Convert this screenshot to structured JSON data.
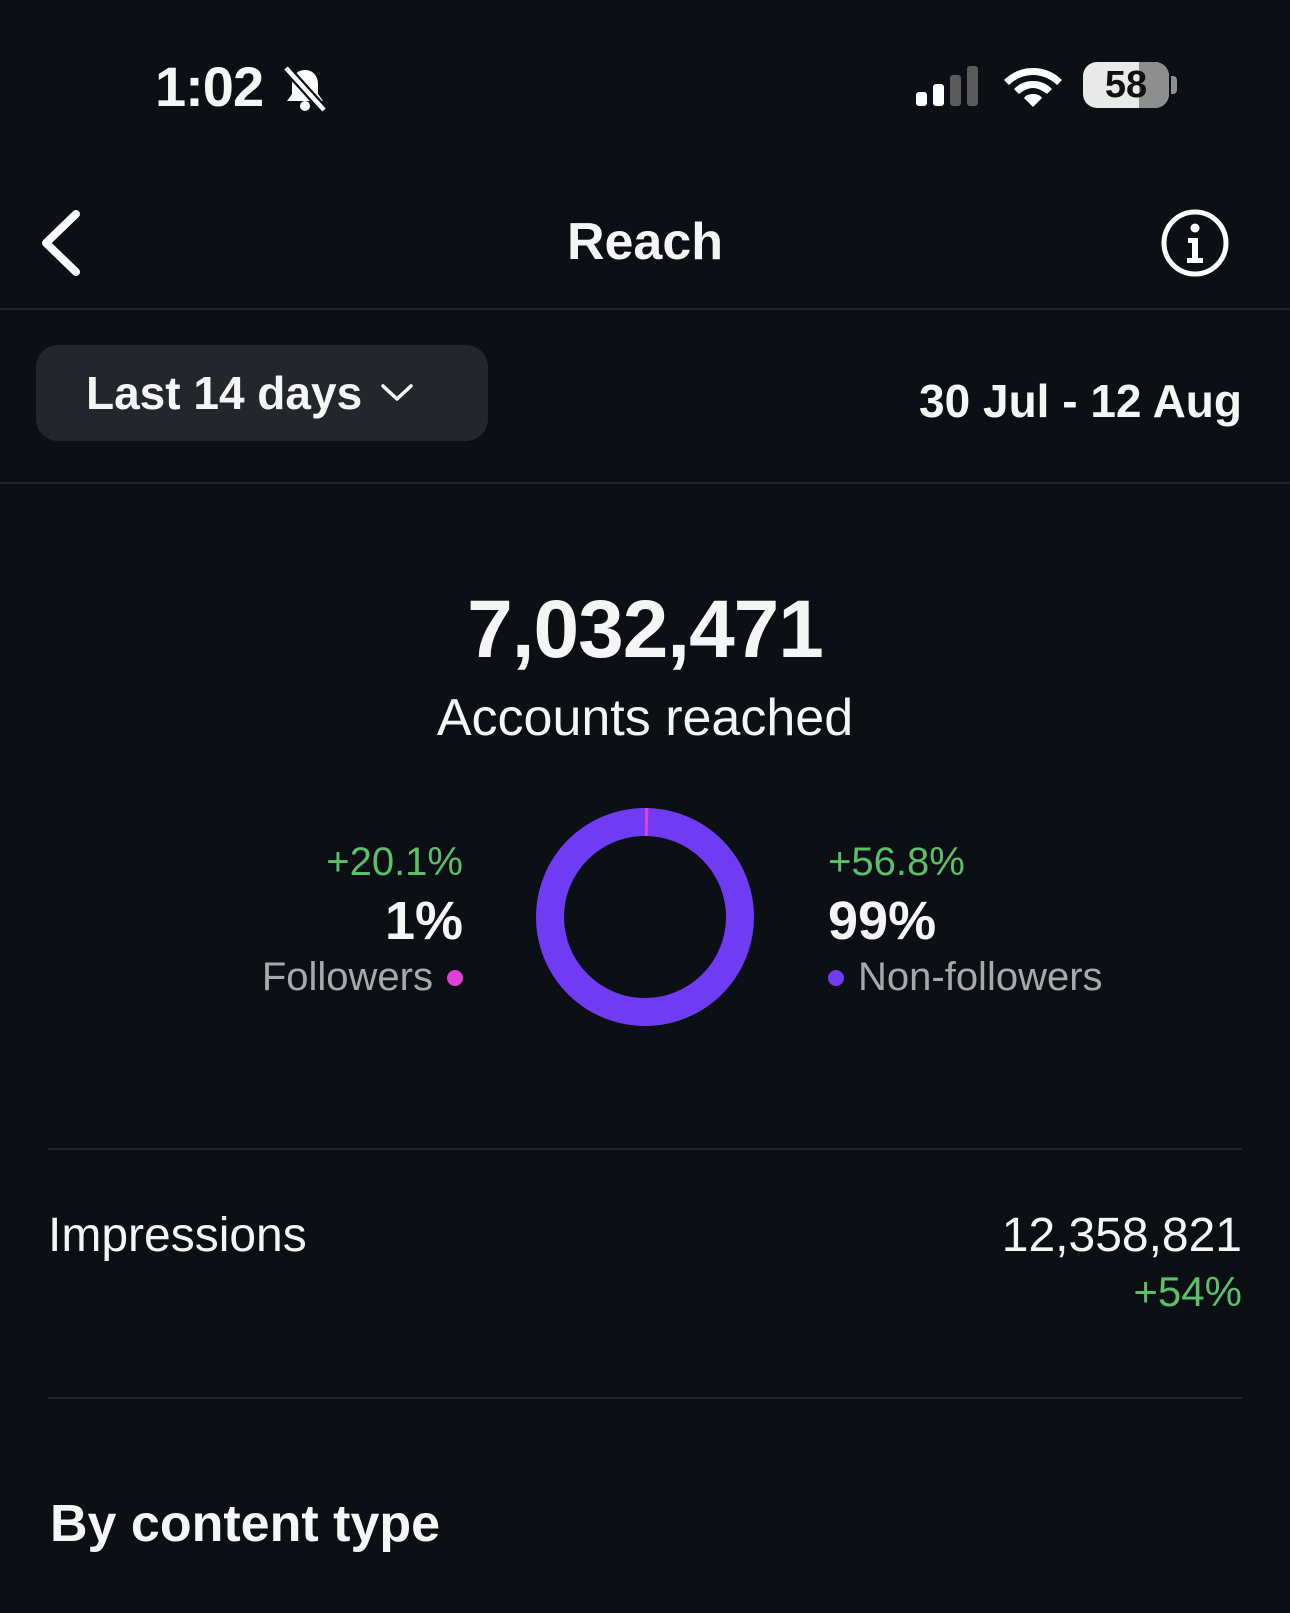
{
  "status_bar": {
    "time": "1:02",
    "battery": "58"
  },
  "nav": {
    "title": "Reach"
  },
  "filter": {
    "range_label": "Last 14 days",
    "date_range": "30 Jul - 12 Aug"
  },
  "summary": {
    "total": "7,032,471",
    "label": "Accounts reached"
  },
  "breakdown": {
    "followers": {
      "change": "+20.1%",
      "percent": "1%",
      "label": "Followers",
      "share": 1,
      "color": "#e040d8"
    },
    "non_followers": {
      "change": "+56.8%",
      "percent": "99%",
      "label": "Non-followers",
      "share": 99,
      "color": "#6f3bf5"
    }
  },
  "impressions": {
    "label": "Impressions",
    "value": "12,358,821",
    "change": "+54%"
  },
  "section": {
    "title": "By content type"
  },
  "colors": {
    "background": "#0c1014",
    "positive": "#5bbf6b",
    "followers": "#e040d8",
    "non_followers": "#6f3bf5"
  }
}
